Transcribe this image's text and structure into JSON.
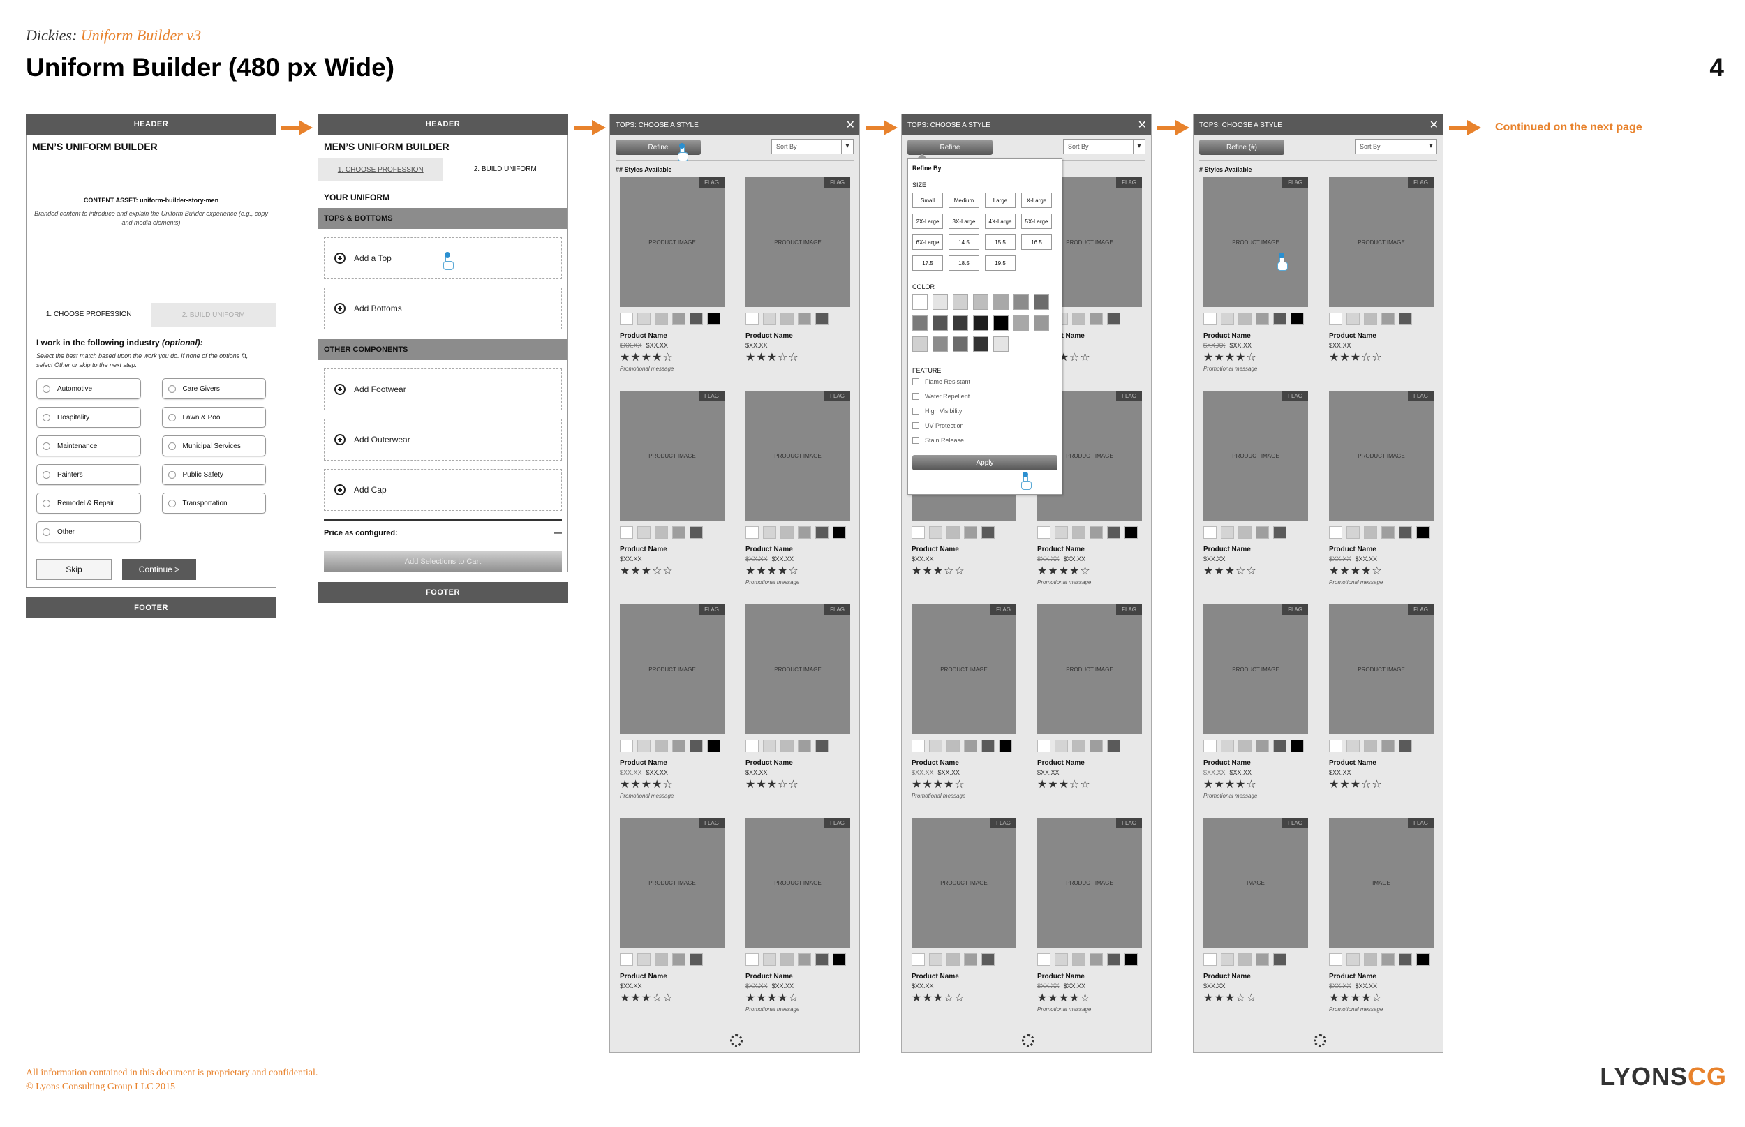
{
  "doc": {
    "brand": "Dickies:",
    "brand_sub": "Uniform Builder v3",
    "title": "Uniform Builder (480 px Wide)",
    "page_number": "4",
    "confidential": "All information contained in this document is proprietary and confidential.",
    "copyright": "© Lyons Consulting Group LLC 2015",
    "logo_main": "LYONS",
    "logo_accent": "CG",
    "continued": "Continued on the next page"
  },
  "colors": {
    "accent": "#e8822c",
    "dark_bar": "#595959",
    "panel_bg": "#e8e8e8"
  },
  "screen1": {
    "header": "HEADER",
    "title": "MEN’S UNIFORM BUILDER",
    "content_asset_label": "CONTENT ASSET: uniform-builder-story-men",
    "content_asset_desc": "Branded content to introduce and explain the Uniform Builder experience (e.g., copy and media elements)",
    "step1": "1. CHOOSE PROFESSION",
    "step2": "2. BUILD UNIFORM",
    "question": "I work in the following industry",
    "question_opt": "(optional):",
    "help": "Select the best match based upon the work you do. If none of the options fit, select Other or skip to the next step.",
    "options": [
      "Automotive",
      "Care Givers",
      "Hospitality",
      "Lawn & Pool",
      "Maintenance",
      "Municipal Services",
      "Painters",
      "Public Safety",
      "Remodel & Repair",
      "Transportation",
      "Other"
    ],
    "skip": "Skip",
    "continue": "Continue >",
    "footer": "FOOTER"
  },
  "screen2": {
    "header": "HEADER",
    "title": "MEN’S UNIFORM BUILDER",
    "step1": "1. CHOOSE PROFESSION",
    "step2": "2. BUILD UNIFORM",
    "your_uniform": "YOUR UNIFORM",
    "tops_bottoms": "TOPS & BOTTOMS",
    "add_top": "Add a Top",
    "add_bottoms": "Add Bottoms",
    "other_components": "OTHER COMPONENTS",
    "add_footwear": "Add Footwear",
    "add_outerwear": "Add Outerwear",
    "add_cap": "Add Cap",
    "price_label": "Price as configured:",
    "price_value": "—",
    "cart_button": "Add Selections to Cart",
    "footer": "FOOTER"
  },
  "plp": {
    "title": "TOPS: CHOOSE A STYLE",
    "close": "✕",
    "refine": "Refine",
    "refine_count": "Refine (#)",
    "sort_by": "Sort By",
    "styles_available_a": "## Styles Available",
    "styles_available_b": "# Styles Available",
    "flag": "FLAG",
    "product_image": "PRODUCT IMAGE",
    "image": "IMAGE",
    "product_name": "Product Name",
    "was_price": "$XX.XX",
    "price": "$XX.XX",
    "promo": "Promotional message",
    "stars_4": "★★★★☆",
    "stars_3": "★★★☆☆"
  },
  "refine_panel": {
    "title": "Refine By",
    "size_label": "SIZE",
    "sizes": [
      "Small",
      "Medium",
      "Large",
      "X-Large",
      "2X-Large",
      "3X-Large",
      "4X-Large",
      "5X-Large",
      "6X-Large",
      "14.5",
      "15.5",
      "16.5",
      "17.5",
      "18.5",
      "19.5"
    ],
    "color_label": "COLOR",
    "feature_label": "FEATURE",
    "features": [
      "Flame Resistant",
      "Water Repellent",
      "High Visibility",
      "UV Protection",
      "Stain Release"
    ],
    "apply": "Apply"
  }
}
